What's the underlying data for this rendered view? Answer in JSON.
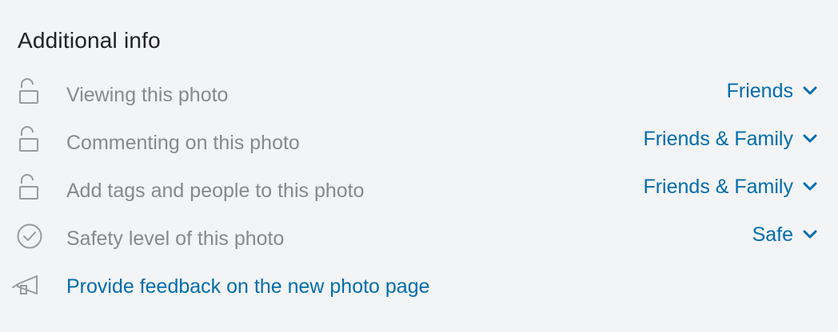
{
  "section": {
    "title": "Additional info"
  },
  "rows": [
    {
      "label": "Viewing this photo",
      "icon": "lock-open-icon",
      "value": "Friends"
    },
    {
      "label": "Commenting on this photo",
      "icon": "lock-open-icon",
      "value": "Friends & Family"
    },
    {
      "label": "Add tags and people to this photo",
      "icon": "lock-open-icon",
      "value": "Friends & Family"
    },
    {
      "label": "Safety level of this photo",
      "icon": "check-circle-icon",
      "value": "Safe"
    }
  ],
  "feedback": {
    "label": "Provide feedback on the new photo page",
    "icon": "megaphone-icon"
  },
  "colors": {
    "background": "#f3f4f6",
    "title": "#212124",
    "label": "#898989",
    "link": "#006dac",
    "icon": "#9a9a9a"
  }
}
